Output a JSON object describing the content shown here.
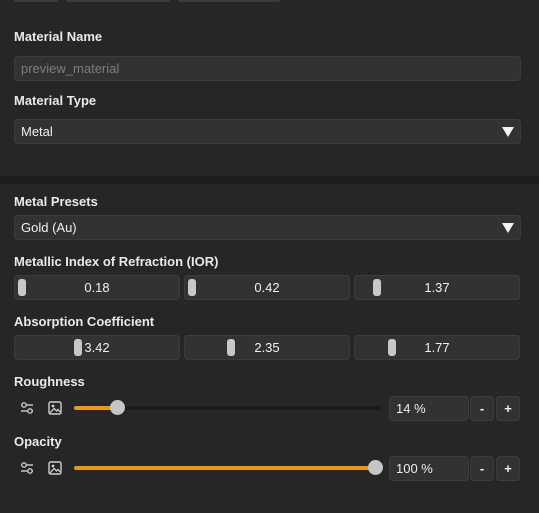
{
  "material_name": {
    "label": "Material Name",
    "placeholder": "preview_material"
  },
  "material_type": {
    "label": "Material Type",
    "value": "Metal"
  },
  "metal_presets": {
    "label": "Metal Presets",
    "value": "Gold (Au)"
  },
  "ior": {
    "label": "Metallic Index of Refraction (IOR)",
    "values": [
      "0.18",
      "0.42",
      "1.37"
    ],
    "levels": [
      0.0,
      0.0,
      0.1
    ]
  },
  "absorption": {
    "label": "Absorption Coefficient",
    "values": [
      "3.42",
      "2.35",
      "1.77"
    ],
    "levels": [
      0.37,
      0.26,
      0.2
    ]
  },
  "roughness": {
    "label": "Roughness",
    "value_text": "14 %",
    "value": 14,
    "minus": "-",
    "plus": "+"
  },
  "opacity": {
    "label": "Opacity",
    "value_text": "100 %",
    "value": 100,
    "minus": "-",
    "plus": "+"
  },
  "icons": {
    "slider_mode": "sliders-icon",
    "texture": "image-icon",
    "dropdown": "caret-down-icon"
  },
  "colors": {
    "accent": "#f0970f",
    "background": "#262626",
    "field": "#323232",
    "knob": "#c6c6c6"
  }
}
